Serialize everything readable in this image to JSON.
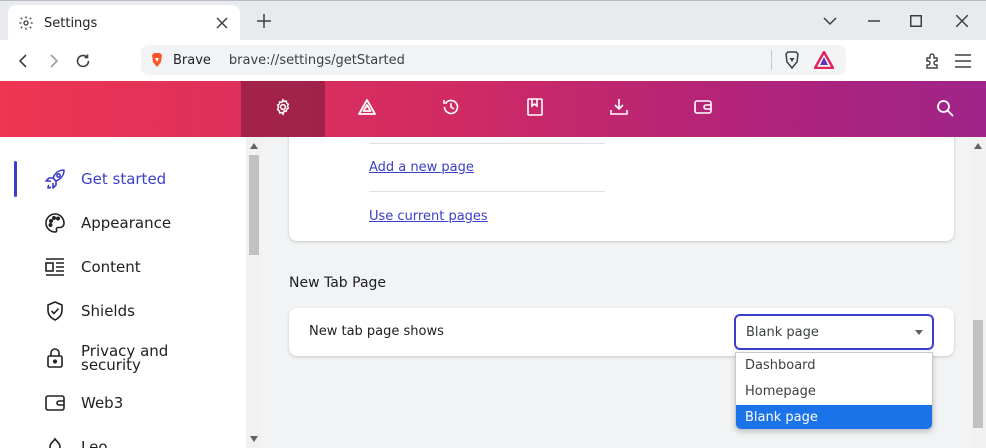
{
  "browser": {
    "tab_title": "Settings",
    "omnibox": {
      "brand": "Brave",
      "url": "brave://settings/getStarted"
    }
  },
  "colors": {
    "accent": "#3b3ec9",
    "header_gradient_start": "#ee3552",
    "header_gradient_end": "#a0248a",
    "option_selected": "#1a73e8"
  },
  "header": {
    "icons": [
      "gear-icon",
      "rewards-triangle-icon",
      "history-icon",
      "bookmarks-icon",
      "downloads-icon",
      "wallet-icon",
      "search-icon"
    ]
  },
  "sidebar": {
    "items": [
      {
        "label": "Get started",
        "icon": "rocket-icon",
        "active": true
      },
      {
        "label": "Appearance",
        "icon": "palette-icon"
      },
      {
        "label": "Content",
        "icon": "content-icon"
      },
      {
        "label": "Shields",
        "icon": "shield-check-icon"
      },
      {
        "label": "Privacy and security",
        "icon": "lock-icon"
      },
      {
        "label": "Web3",
        "icon": "wallet-icon"
      },
      {
        "label": "Leo",
        "icon": "leo-icon"
      }
    ]
  },
  "startup_card": {
    "add_page_link": "Add a new page",
    "use_current_link": "Use current pages"
  },
  "new_tab": {
    "section_title": "New Tab Page",
    "row_label": "New tab page shows",
    "selected": "Blank page",
    "options": [
      "Dashboard",
      "Homepage",
      "Blank page"
    ]
  }
}
